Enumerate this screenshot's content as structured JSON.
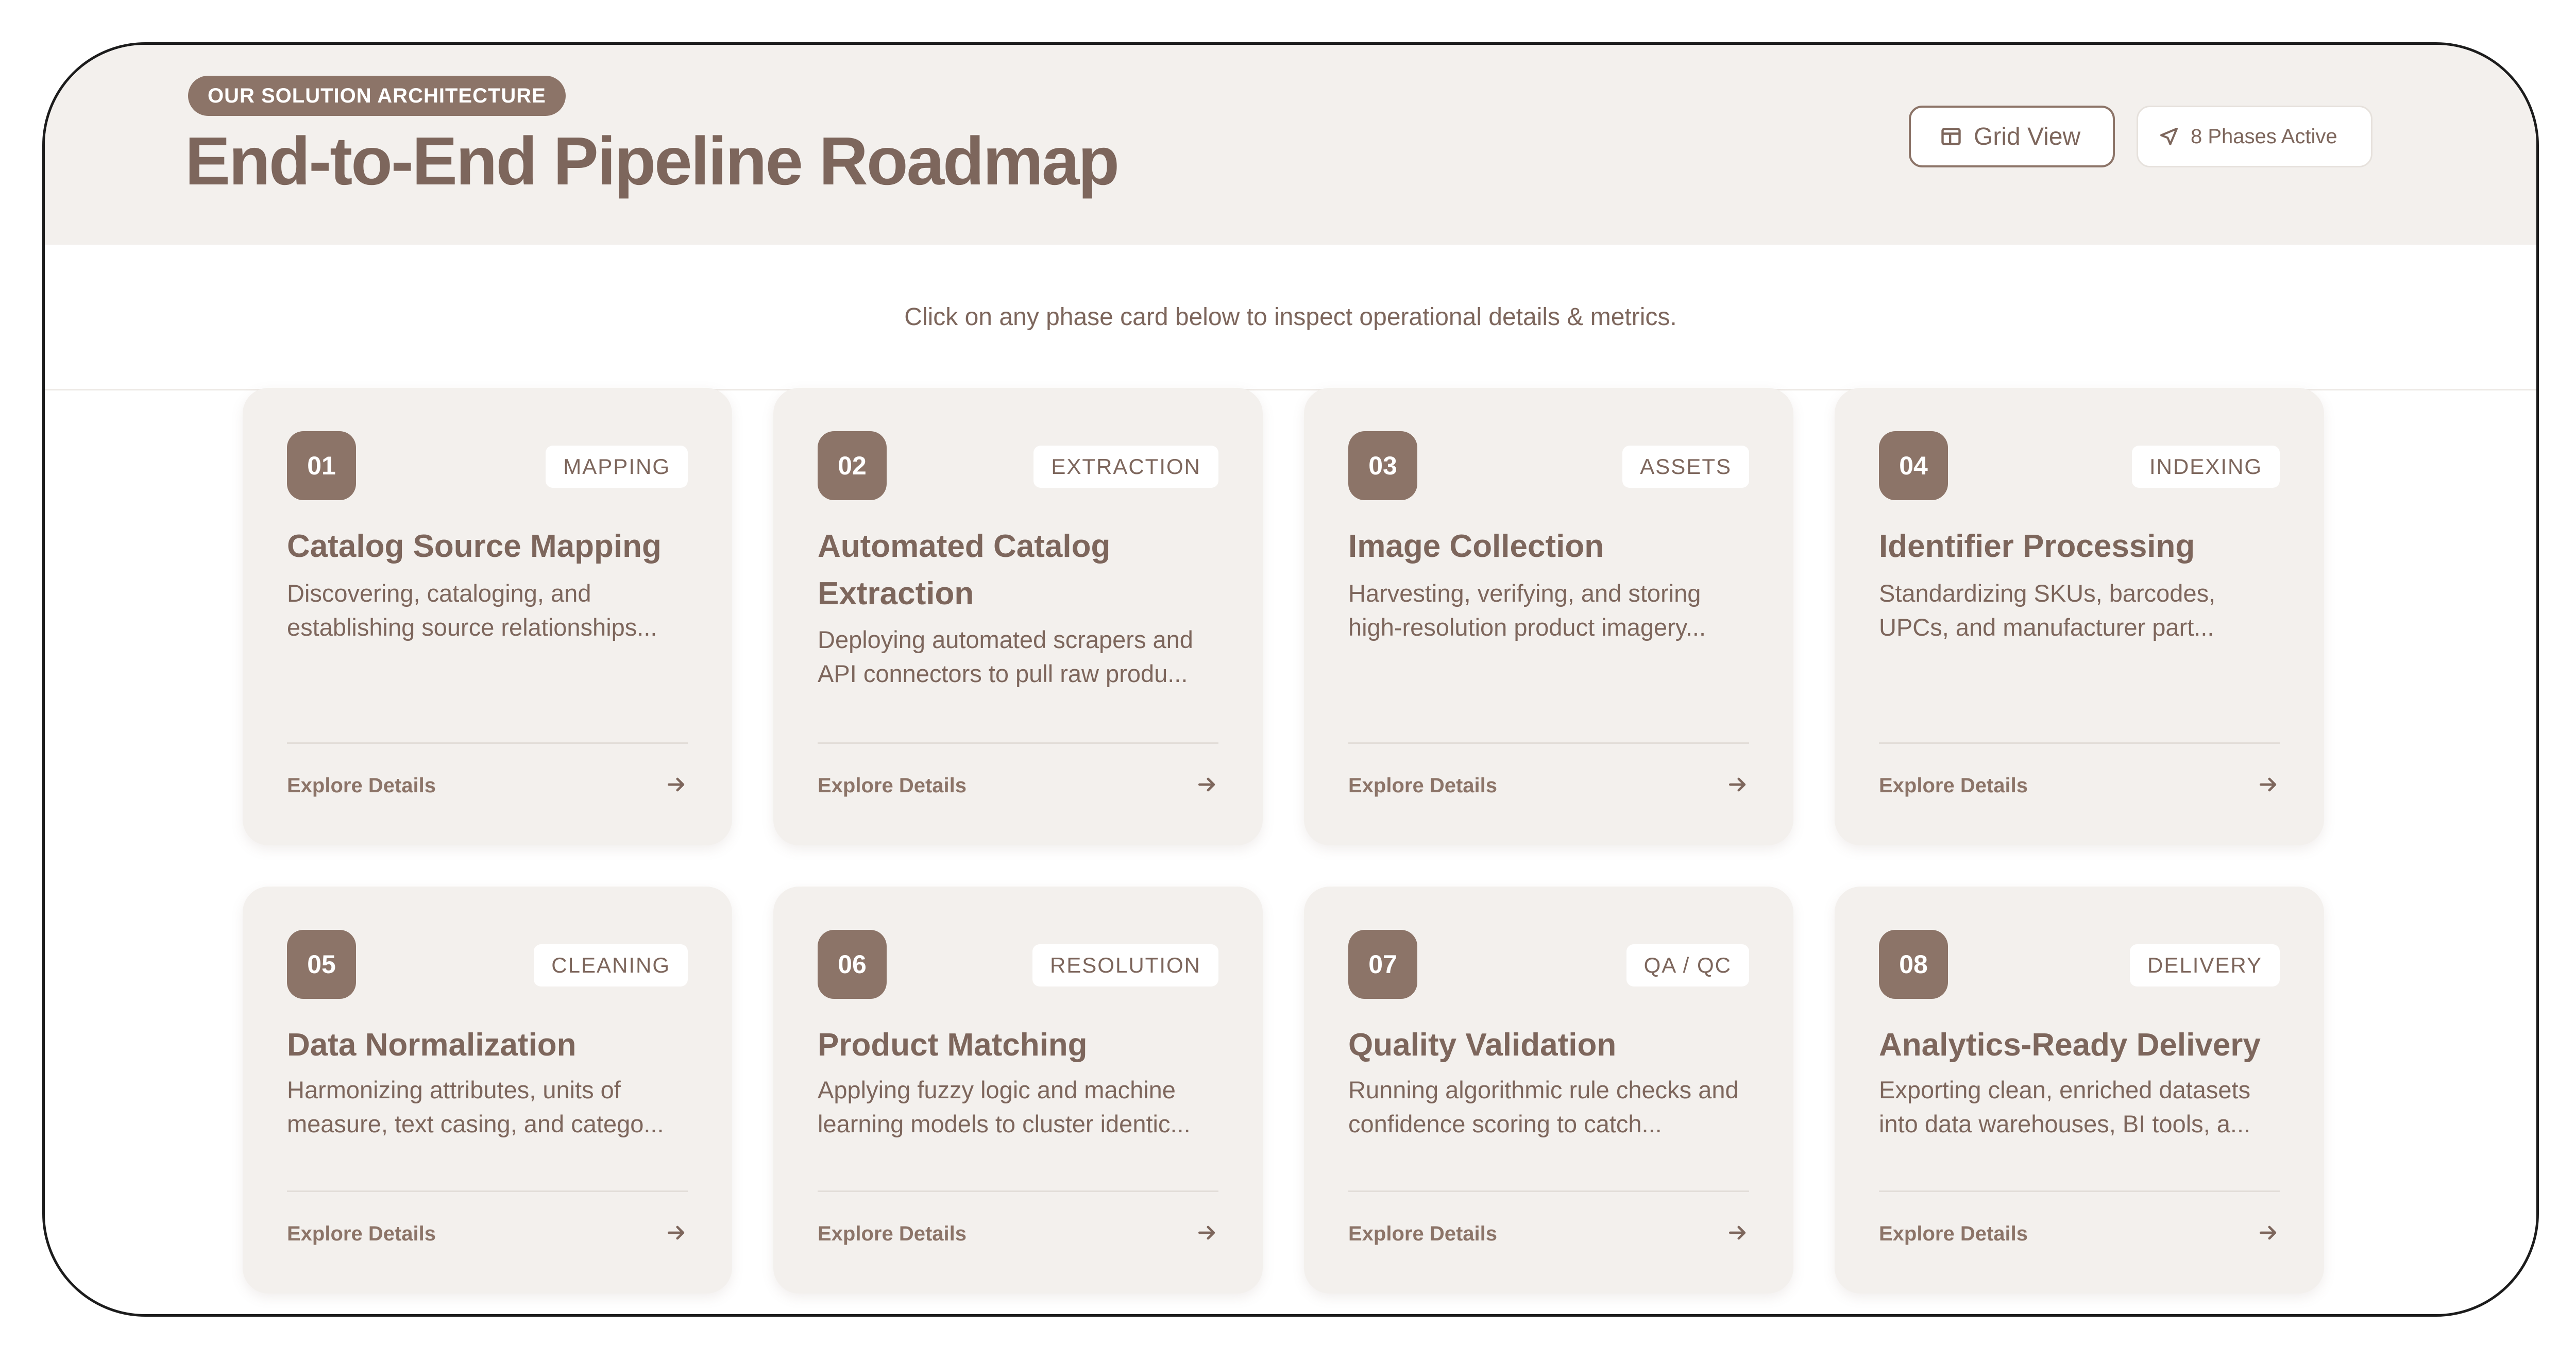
{
  "header": {
    "badge": "OUR SOLUTION ARCHITECTURE",
    "title": "End-to-End Pipeline Roadmap",
    "grid_view_label": "Grid View",
    "phases_active_label": "8 Phases Active"
  },
  "instruction": "Click on any phase card below to inspect operational details & metrics.",
  "phases": [
    {
      "number": "01",
      "tag": "MAPPING",
      "title": "Catalog Source Mapping",
      "description": "Discovering, cataloging, and establishing source relationships...",
      "link": "Explore Details"
    },
    {
      "number": "02",
      "tag": "EXTRACTION",
      "title": "Automated Catalog Extraction",
      "description": "Deploying automated scrapers and API connectors to pull raw produ...",
      "link": "Explore Details"
    },
    {
      "number": "03",
      "tag": "ASSETS",
      "title": "Image Collection",
      "description": "Harvesting, verifying, and storing high-resolution product imagery...",
      "link": "Explore Details"
    },
    {
      "number": "04",
      "tag": "INDEXING",
      "title": "Identifier Processing",
      "description": "Standardizing SKUs, barcodes, UPCs, and manufacturer part...",
      "link": "Explore Details"
    },
    {
      "number": "05",
      "tag": "CLEANING",
      "title": "Data Normalization",
      "description": "Harmonizing attributes, units of measure, text casing, and catego...",
      "link": "Explore Details"
    },
    {
      "number": "06",
      "tag": "RESOLUTION",
      "title": "Product Matching",
      "description": "Applying fuzzy logic and machine learning models to cluster identic...",
      "link": "Explore Details"
    },
    {
      "number": "07",
      "tag": "QA / QC",
      "title": "Quality Validation",
      "description": "Running algorithmic rule checks and confidence scoring to catch...",
      "link": "Explore Details"
    },
    {
      "number": "08",
      "tag": "DELIVERY",
      "title": "Analytics-Ready Delivery",
      "description": "Exporting clean, enriched datasets into data warehouses, BI tools, a...",
      "link": "Explore Details"
    }
  ],
  "icons": {
    "grid_view": "layout-icon",
    "phases_active": "navigation-arrow-icon",
    "explore": "arrow-right-icon"
  },
  "colors": {
    "accent": "#8c7468",
    "heading": "#7d665c",
    "card_bg": "#f3f0ed",
    "header_bg": "#f3f0ed",
    "border": "#1c1c1c"
  }
}
